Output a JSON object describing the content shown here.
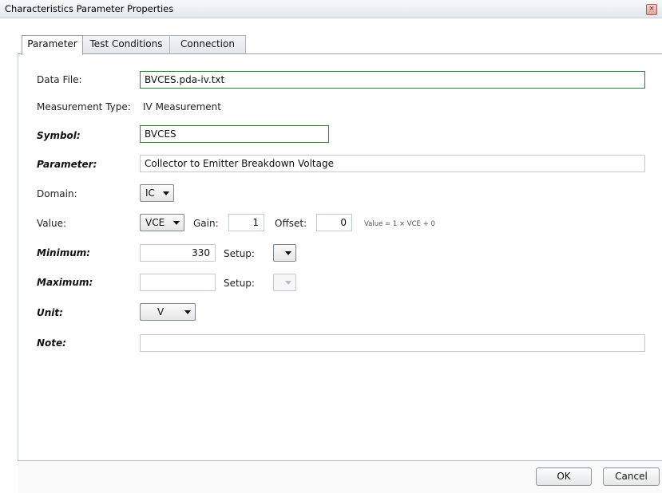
{
  "window": {
    "title": "Characteristics Parameter Properties",
    "close_glyph": "×"
  },
  "tabs": [
    {
      "label": "Parameter"
    },
    {
      "label": "Test Conditions"
    },
    {
      "label": "Connection"
    }
  ],
  "form": {
    "data_file": {
      "label": "Data File:",
      "value": "BVCES.pda-iv.txt"
    },
    "measurement_type": {
      "label": "Measurement Type:",
      "value": "IV Measurement"
    },
    "symbol": {
      "label": "Symbol:",
      "value": "BVCES"
    },
    "parameter": {
      "label": "Parameter:",
      "value": "Collector to Emitter Breakdown Voltage"
    },
    "domain": {
      "label": "Domain:",
      "value": "IC"
    },
    "value": {
      "label": "Value:",
      "selected": "VCE",
      "gain_label": "Gain:",
      "gain": "1",
      "offset_label": "Offset:",
      "offset": "0",
      "formula": "Value = 1 × VCE + 0"
    },
    "minimum": {
      "label": "Minimum:",
      "value": "330",
      "setup_label": "Setup:",
      "setup_value": ""
    },
    "maximum": {
      "label": "Maximum:",
      "value": "",
      "setup_label": "Setup:",
      "setup_value": ""
    },
    "unit": {
      "label": "Unit:",
      "value": "V"
    },
    "note": {
      "label": "Note:",
      "value": ""
    }
  },
  "footer": {
    "ok_label": "OK",
    "cancel_label": "Cancel"
  }
}
